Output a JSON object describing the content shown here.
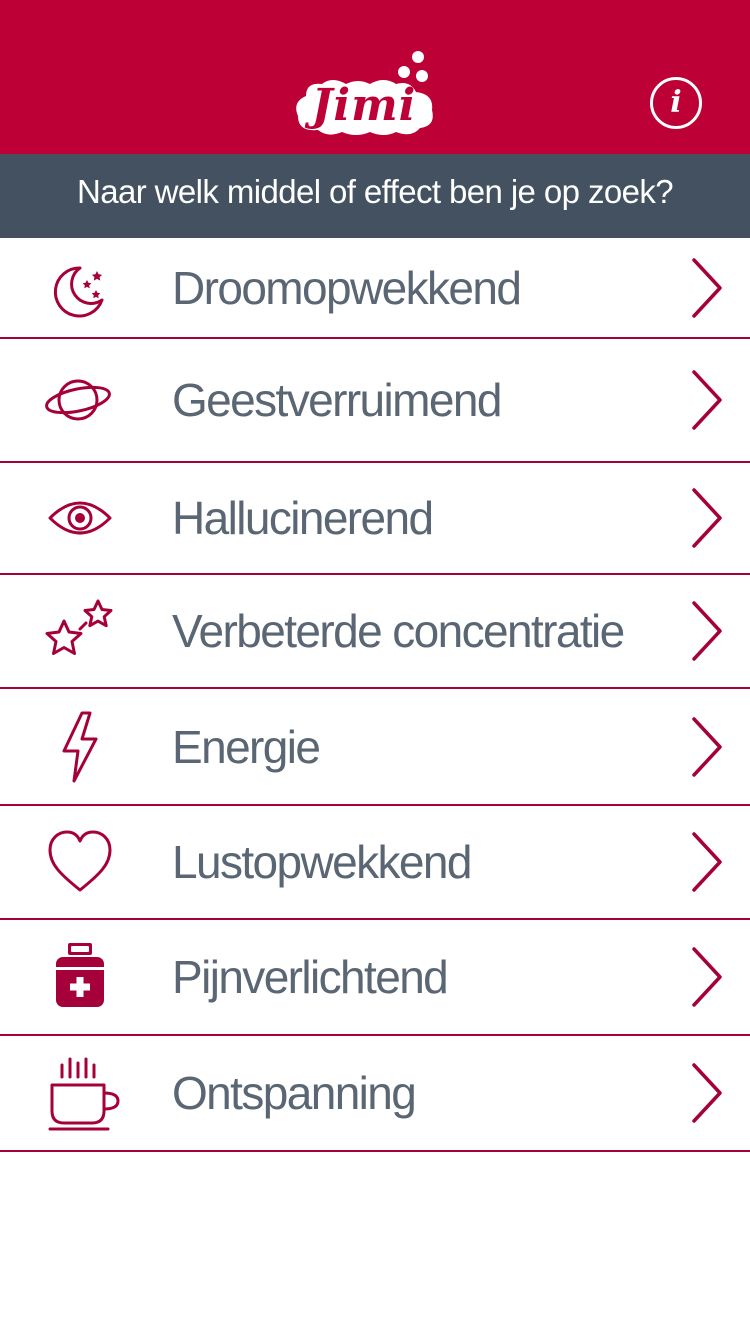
{
  "colors": {
    "brand": "#bd0036",
    "subtitle_bar": "#435160",
    "label_text": "#5a6673",
    "accent": "#a5003a"
  },
  "header": {
    "logo_text": "Jimi",
    "info_label": "i"
  },
  "subtitle": "Naar welk middel of effect ben je op zoek?",
  "menu": {
    "items": [
      {
        "label": "Droomopwekkend",
        "icon": "moon-stars-icon"
      },
      {
        "label": "Geestverruimend",
        "icon": "planet-icon"
      },
      {
        "label": "Hallucinerend",
        "icon": "eye-icon"
      },
      {
        "label": "Verbeterde concentratie",
        "icon": "stars-icon"
      },
      {
        "label": "Energie",
        "icon": "lightning-icon"
      },
      {
        "label": "Lustopwekkend",
        "icon": "heart-icon"
      },
      {
        "label": "Pijnverlichtend",
        "icon": "medicine-bottle-icon"
      },
      {
        "label": "Ontspanning",
        "icon": "tea-cup-icon"
      }
    ]
  }
}
